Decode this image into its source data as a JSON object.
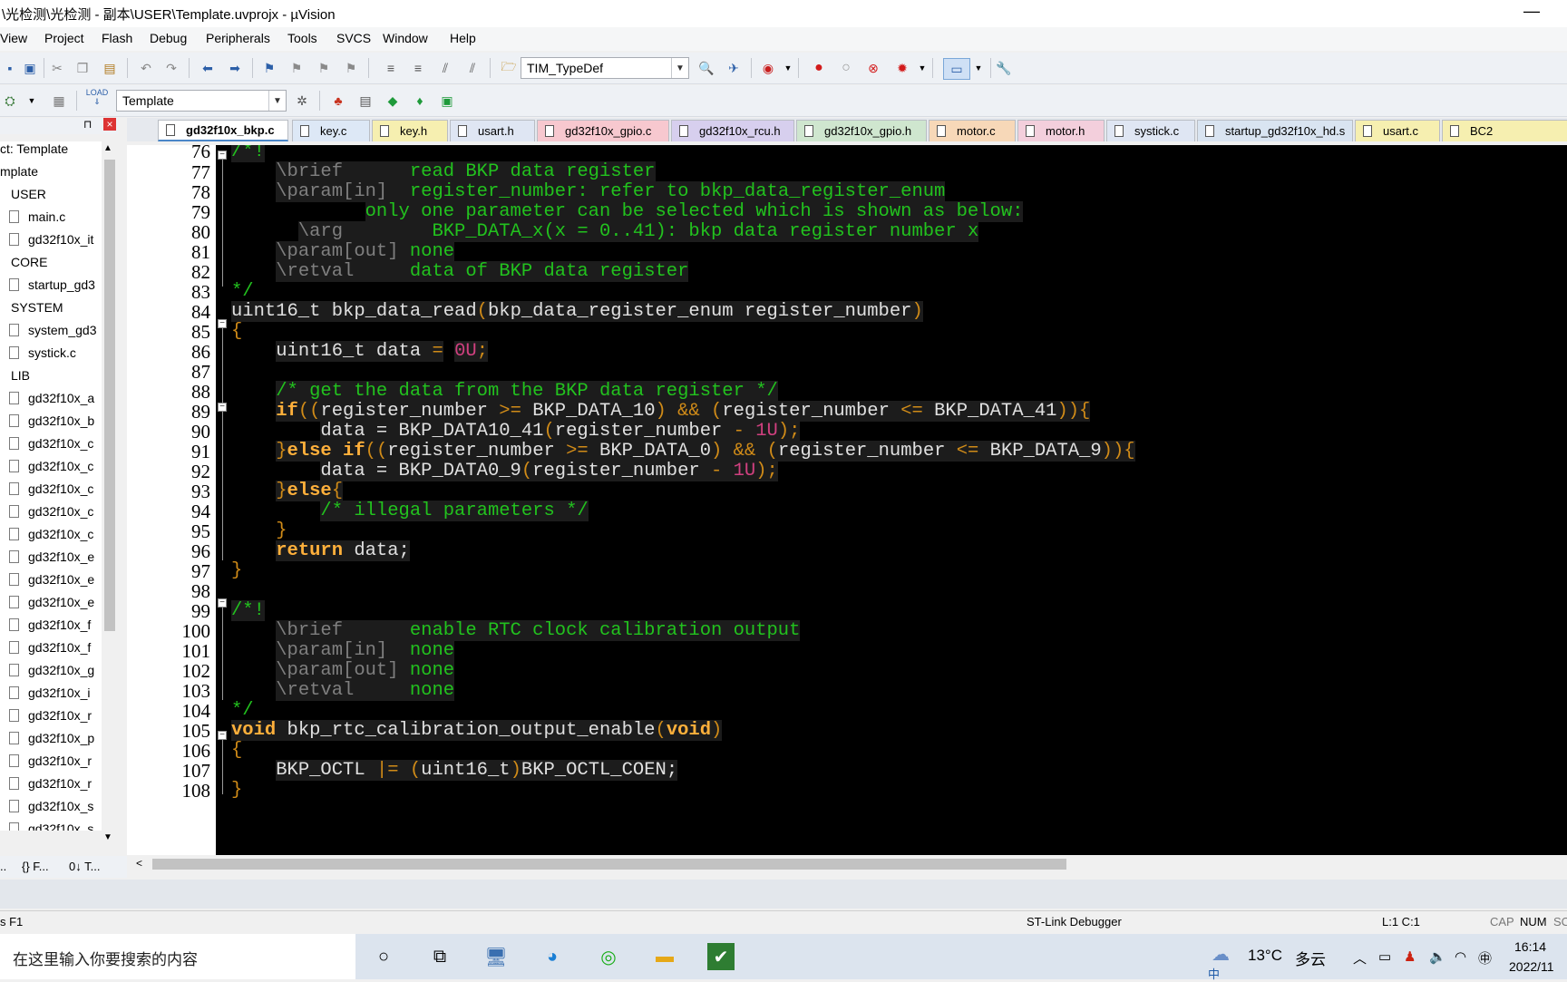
{
  "window": {
    "title": "\\光检测\\光检测 - 副本\\USER\\Template.uvprojx - µVision",
    "minimize": "—"
  },
  "menu": [
    "View",
    "Project",
    "Flash",
    "Debug",
    "Peripherals",
    "Tools",
    "SVCS",
    "Window",
    "Help"
  ],
  "toolbar": {
    "find_combo": "TIM_TypeDef",
    "target_combo": "Template",
    "load_label": "LOAD"
  },
  "tabs": [
    "gd32f10x_bkp.c",
    "key.c",
    "key.h",
    "usart.h",
    "gd32f10x_gpio.c",
    "gd32f10x_rcu.h",
    "gd32f10x_gpio.h",
    "motor.c",
    "motor.h",
    "systick.c",
    "startup_gd32f10x_hd.s",
    "usart.c",
    "BC2"
  ],
  "tab_colors": [
    "#ffffff",
    "#dde8f6",
    "#f6efb0",
    "#dfe6f3",
    "#f7c8cf",
    "#d7cfee",
    "#cfe6cf",
    "#f7d8b8",
    "#f3cfdc",
    "#dfe6f3",
    "#d9e4f1",
    "#f6efb0",
    "#f6efb0"
  ],
  "project_tree": {
    "header_pin": "⊓",
    "header_close": "×",
    "items": [
      "ct: Template",
      "mplate",
      "USER",
      "main.c",
      "gd32f10x_it",
      "CORE",
      "startup_gd3",
      "SYSTEM",
      "system_gd3",
      "systick.c",
      "LIB",
      "gd32f10x_a",
      "gd32f10x_b",
      "gd32f10x_c",
      "gd32f10x_c",
      "gd32f10x_c",
      "gd32f10x_c",
      "gd32f10x_c",
      "gd32f10x_e",
      "gd32f10x_e",
      "gd32f10x_e",
      "gd32f10x_f",
      "gd32f10x_f",
      "gd32f10x_g",
      "gd32f10x_i",
      "gd32f10x_r",
      "gd32f10x_p",
      "gd32f10x_r",
      "gd32f10x_r",
      "gd32f10x_s",
      "gd32f10x_s"
    ]
  },
  "panel_tabs": [
    "..",
    "{} F...",
    "0↓ T..."
  ],
  "code": {
    "line_numbers": [
      "76",
      "77",
      "78",
      "79",
      "80",
      "81",
      "82",
      "83",
      "84",
      "85",
      "86",
      "87",
      "88",
      "89",
      "90",
      "91",
      "92",
      "93",
      "94",
      "95",
      "96",
      "97",
      "98",
      "99",
      "100",
      "101",
      "102",
      "103",
      "104",
      "105",
      "106",
      "107",
      "108"
    ],
    "l76": "/*!",
    "l77_tag": "\\brief",
    "l77_txt": "read BKP data register",
    "l78_tag": "\\param[in]",
    "l78_txt": "register_number: refer to bkp_data_register_enum",
    "l79_txt": "only one parameter can be selected which is shown as below:",
    "l80_tag": "\\arg",
    "l80_txt": "BKP_DATA_x(x = 0..41): bkp data register number x",
    "l81_tag": "\\param[out]",
    "l81_txt": "none",
    "l82_tag": "\\retval",
    "l82_txt": "data of BKP data register",
    "l83": "*/",
    "l84_a": "uint16_t bkp_data_read",
    "l84_b": "(",
    "l84_c": "bkp_data_register_enum register_number",
    "l84_d": ")",
    "l85": "{",
    "l86_a": "uint16_t data ",
    "l86_b": "=",
    "l86_c": "0U",
    "l86_d": ";",
    "l88": "/* get the data from the BKP data register */",
    "l89_if": "if",
    "l89_a": "((",
    "l89_b": "register_number ",
    "l89_c": ">=",
    "l89_d": " BKP_DATA_10",
    "l89_e": ")",
    "l89_f": " && ",
    "l89_g": "(",
    "l89_h": "register_number ",
    "l89_i": "<=",
    "l89_j": " BKP_DATA_41",
    "l89_k": ")){",
    "l90_a": "data = BKP_DATA10_41",
    "l90_b": "(",
    "l90_c": "register_number ",
    "l90_d": "-",
    "l90_e": " 1U",
    "l90_f": ");",
    "l91_a": "}",
    "l91_else": "else if",
    "l91_b": "((",
    "l91_c": "register_number ",
    "l91_d": ">=",
    "l91_e": " BKP_DATA_0",
    "l91_f": ")",
    "l91_g": " && ",
    "l91_h": "(",
    "l91_i": "register_number ",
    "l91_j": "<=",
    "l91_k": " BKP_DATA_9",
    "l91_l": ")){",
    "l92_a": "data = BKP_DATA0_9",
    "l92_b": "(",
    "l92_c": "register_number ",
    "l92_d": "-",
    "l92_e": " 1U",
    "l92_f": ");",
    "l93_a": "}",
    "l93_else": "else",
    "l93_b": "{",
    "l94": "/* illegal parameters */",
    "l95": "}",
    "l96_kw": "return",
    "l96_txt": " data;",
    "l97": "}",
    "l99": "/*!",
    "l100_tag": "\\brief",
    "l100_txt": "enable RTC clock calibration output",
    "l101_tag": "\\param[in]",
    "l101_txt": "none",
    "l102_tag": "\\param[out]",
    "l102_txt": "none",
    "l103_tag": "\\retval",
    "l103_txt": "none",
    "l104": "*/",
    "l105_kw": "void",
    "l105_a": " bkp_rtc_calibration_output_enable",
    "l105_b": "(",
    "l105_kw2": "void",
    "l105_c": ")",
    "l106": "{",
    "l107_a": "BKP_OCTL ",
    "l107_b": "|=",
    "l107_c": " (",
    "l107_d": "uint16_t",
    "l107_e": ")",
    "l107_f": "BKP_OCTL_COEN;",
    "l108": "}"
  },
  "status": {
    "left": "s F1",
    "debugger": "ST-Link Debugger",
    "cursor": "L:1 C:1",
    "cap": "CAP",
    "num": "NUM",
    "scrl": "SC"
  },
  "taskbar": {
    "search_placeholder": "在这里输入你要搜索的内容",
    "weather_temp": "13°C",
    "weather_text": "多云",
    "time": "16:14",
    "date": "2022/11",
    "ime_lang": "中"
  }
}
